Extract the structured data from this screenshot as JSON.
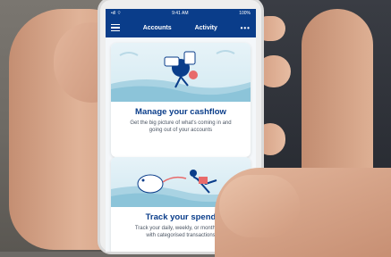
{
  "statusbar": {
    "left": "•ıll ⌔",
    "time": "9:41 AM",
    "right": "100%"
  },
  "navbar": {
    "tabs": [
      {
        "label": "Accounts"
      },
      {
        "label": "Activity"
      }
    ],
    "more_label": "•••"
  },
  "cards": [
    {
      "title": "Manage your cashflow",
      "body_line1": "Get the big picture of what's coming in and",
      "body_line2": "going out of your accounts"
    },
    {
      "title": "Track your spend",
      "body_line1": "Track your daily, weekly, or monthly sp",
      "body_line2": "with categorised transactions"
    }
  ],
  "colors": {
    "header": "#0a3d8a",
    "title": "#0a3d8a",
    "illustration_bg": "#e7f3f8",
    "accent_coral": "#e86a6a"
  },
  "icons": [
    "menu-icon",
    "more-icon",
    "cashflow-illustration",
    "piggy-bank-illustration"
  ]
}
